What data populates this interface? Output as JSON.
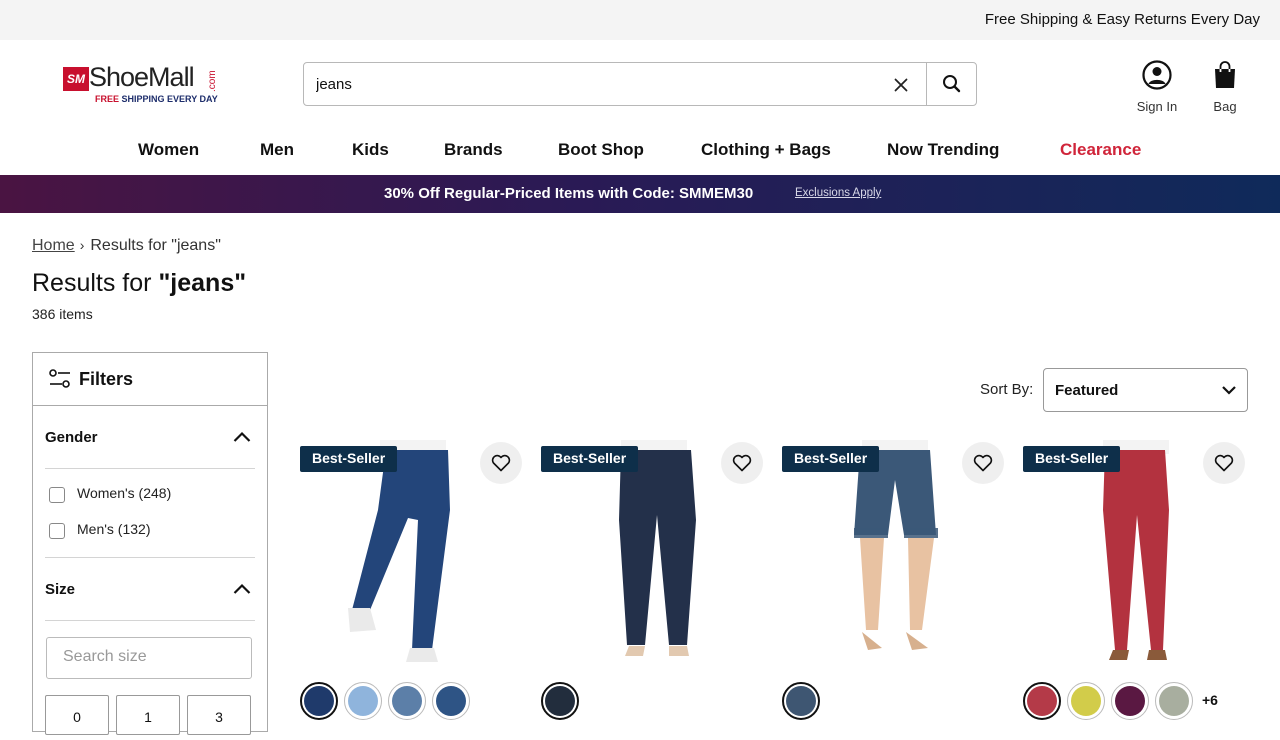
{
  "topbar": {
    "shipping_text": "Free Shipping & Easy Returns Every Day"
  },
  "logo": {
    "mark": "SM",
    "word": "ShoeMall",
    "dotcom": ".com",
    "tag_free": "FREE",
    "tag_rest": " SHIPPING EVERY DAY"
  },
  "search": {
    "value": "jeans"
  },
  "header": {
    "sign_in_label": "Sign In",
    "bag_label": "Bag"
  },
  "nav": {
    "items": [
      {
        "label": "Women"
      },
      {
        "label": "Men"
      },
      {
        "label": "Kids"
      },
      {
        "label": "Brands"
      },
      {
        "label": "Boot Shop"
      },
      {
        "label": "Clothing + Bags"
      },
      {
        "label": "Now Trending"
      },
      {
        "label": "Clearance"
      }
    ]
  },
  "promo": {
    "text": "30% Off Regular-Priced Items with Code: SMMEM30",
    "link": "Exclusions Apply"
  },
  "breadcrumb": {
    "home": "Home",
    "sep": "›",
    "current": "Results for  \"jeans\""
  },
  "results": {
    "title_prefix": "Results for ",
    "query": "\"jeans\"",
    "count": "386 items"
  },
  "filters": {
    "title": "Filters",
    "gender": {
      "label": "Gender",
      "options": [
        "Women's (248)",
        "Men's (132)"
      ]
    },
    "size": {
      "label": "Size",
      "search_placeholder": "Search size",
      "options": [
        "0",
        "1",
        "3"
      ]
    }
  },
  "sort": {
    "label": "Sort By:",
    "value": "Featured"
  },
  "products": [
    {
      "badge": "Best-Seller",
      "colors": [
        "#1f3a6b",
        "#8fb4dc",
        "#5c7fa8",
        "#2e5485"
      ],
      "pant": "#23457a",
      "style": "bootcut"
    },
    {
      "badge": "Best-Seller",
      "colors": [
        "#222d3d"
      ],
      "pant": "#23304a",
      "style": "straight"
    },
    {
      "badge": "Best-Seller",
      "colors": [
        "#3e5672"
      ],
      "pant": "#3b5878",
      "style": "short"
    },
    {
      "badge": "Best-Seller",
      "colors": [
        "#b43a48",
        "#d2cc4a",
        "#5a1842",
        "#a8ae9f"
      ],
      "more": "+6",
      "pant": "#b3323f",
      "style": "skinny"
    }
  ]
}
